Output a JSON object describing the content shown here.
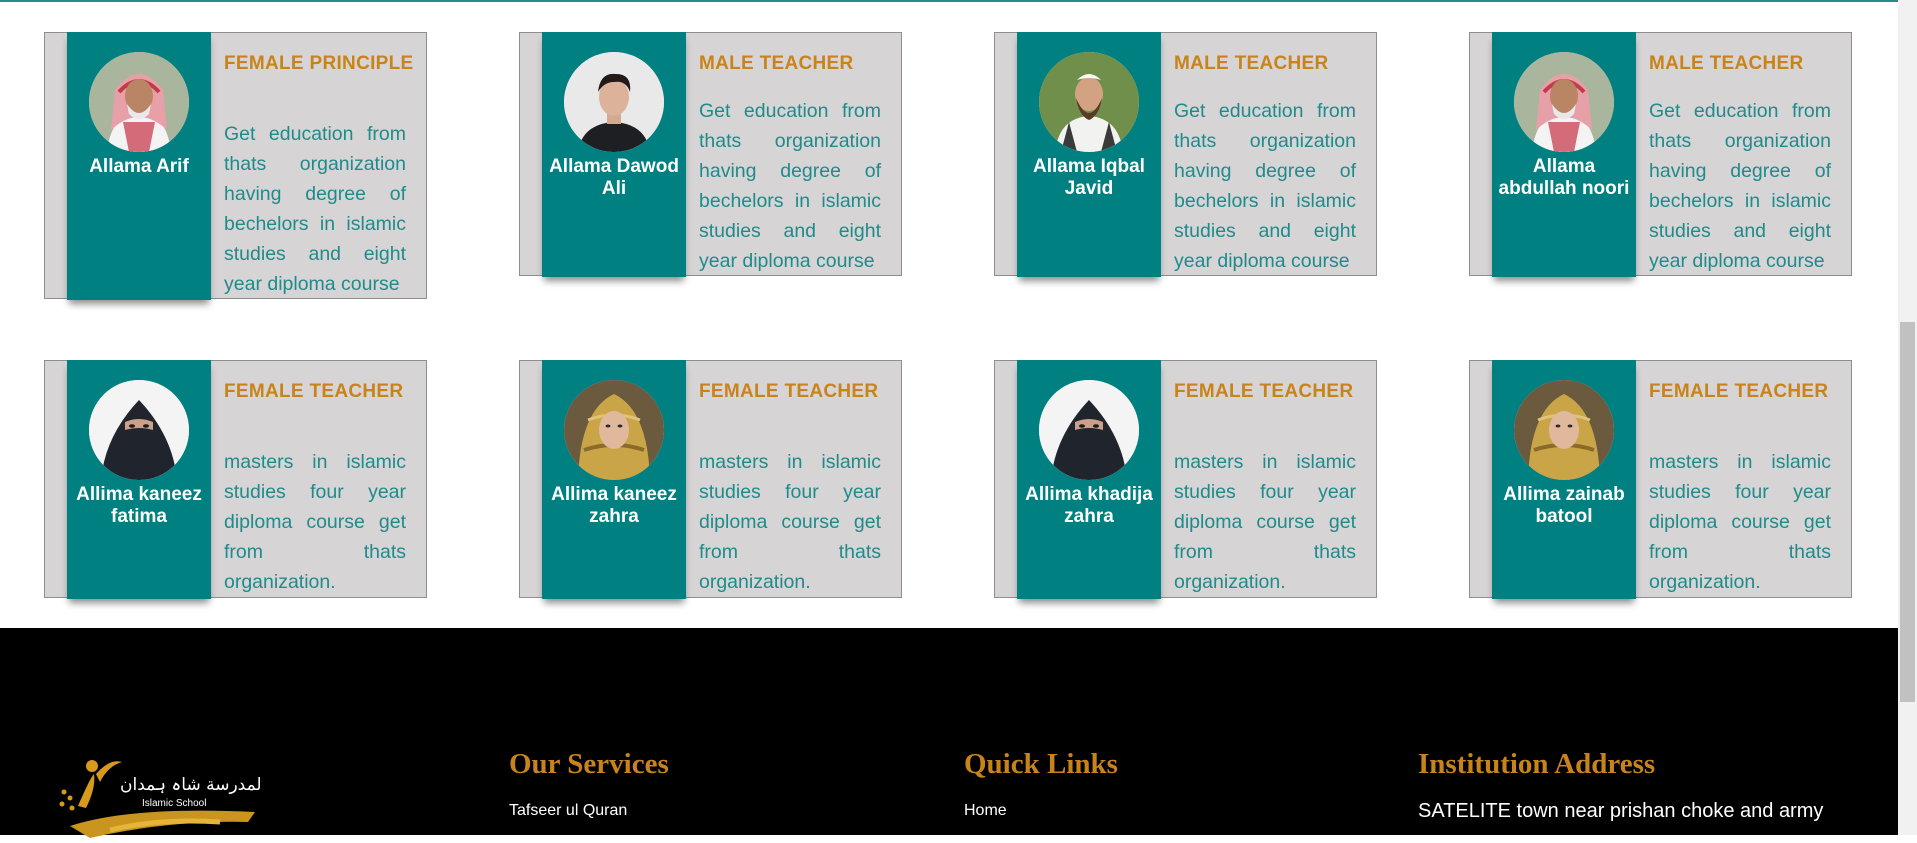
{
  "teachers": [
    {
      "name": "Allama Arif",
      "role": "FEMALE PRINCIPLE",
      "desc": "Get education from thats organization having degree of bechelors in islamic studies and eight year diploma course",
      "avatar": "man-red-scarf"
    },
    {
      "name": "Allama Dawod Ali",
      "role": "MALE TEACHER",
      "desc": "Get education from thats organization having degree of bechelors in islamic studies and eight year diploma course",
      "avatar": "young-man"
    },
    {
      "name": "Allama Iqbal Javid",
      "role": "MALE TEACHER",
      "desc": "Get education from thats organization having degree of bechelors in islamic studies and eight year diploma course",
      "avatar": "bearded-man"
    },
    {
      "name": "Allama abdullah noori",
      "role": "MALE TEACHER",
      "desc": "Get education from thats organization having degree of bechelors in islamic studies and eight year diploma course",
      "avatar": "man-red-scarf"
    },
    {
      "name": "Allima kaneez fatima",
      "role": "FEMALE TEACHER",
      "desc": "masters in islamic studies four year diploma course get from thats organization.",
      "avatar": "woman-niqab"
    },
    {
      "name": "Allima kaneez zahra",
      "role": "FEMALE TEACHER",
      "desc": "masters in islamic studies four year diploma course get from thats organization.",
      "avatar": "woman-hijab"
    },
    {
      "name": "Allima khadija zahra",
      "role": "FEMALE TEACHER",
      "desc": "masters in islamic studies four year diploma course get from thats organization.",
      "avatar": "woman-niqab"
    },
    {
      "name": "Allima zainab batool",
      "role": "FEMALE TEACHER",
      "desc": "masters in islamic studies four year diploma course get from thats organization.",
      "avatar": "woman-hijab"
    }
  ],
  "footer": {
    "logo_arabic": "المدرسة شاہ ہمدان",
    "logo_english": "Islamic School",
    "services_title": "Our Services",
    "services_first": "Tafseer ul Quran",
    "links_title": "Quick Links",
    "links_first": "Home",
    "address_title": "Institution Address",
    "address_text": "SATELITE town near prishan choke and army"
  },
  "colors": {
    "teal": "#008080",
    "gold": "#c8841b",
    "card": "#d6d4d5",
    "footer": "#000000"
  }
}
